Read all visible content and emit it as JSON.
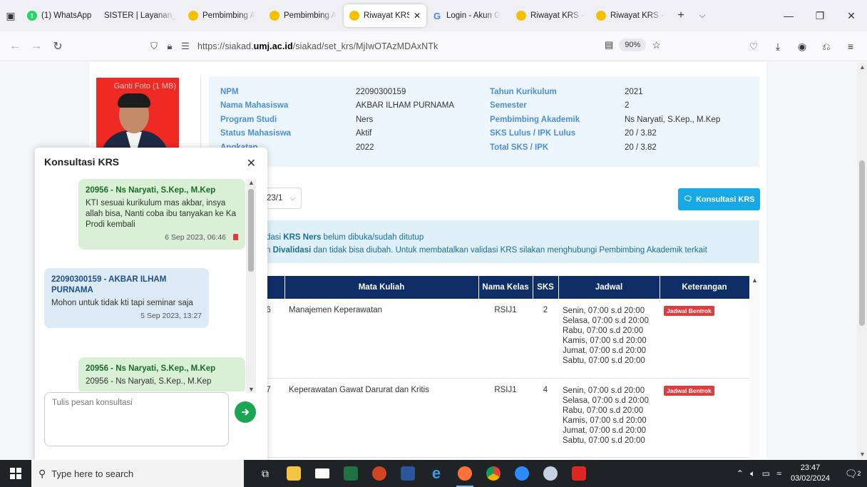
{
  "browser": {
    "tabs": [
      {
        "label": "(1) WhatsApp",
        "icon": "whatsapp-icon",
        "color": "#25d366",
        "active": false
      },
      {
        "label": "SISTER | Layanan_b",
        "icon": "sister-icon",
        "color": "#f0f0f4",
        "active": false
      },
      {
        "label": "Pembimbing A",
        "icon": "umj-icon",
        "color": "#f2c200",
        "active": false
      },
      {
        "label": "Pembimbing A",
        "icon": "umj-icon",
        "color": "#f2c200",
        "active": false
      },
      {
        "label": "Riwayat KRS",
        "icon": "umj-icon",
        "color": "#f2c200",
        "active": true
      },
      {
        "label": "Login - Akun G",
        "icon": "google-icon",
        "color": "#4285f4",
        "active": false
      },
      {
        "label": "Riwayat KRS - l",
        "icon": "umj-icon",
        "color": "#f2c200",
        "active": false
      },
      {
        "label": "Riwayat KRS - l",
        "icon": "umj-icon",
        "color": "#f2c200",
        "active": false
      }
    ],
    "url_prefix": "https://siakad.",
    "url_domain": "umj.ac.id",
    "url_path": "/siakad/set_krs/MjIwOTAzMDAxNTk",
    "zoom": "90%"
  },
  "profile": {
    "photo_label": "Ganti Foto (1 MB)",
    "left": [
      {
        "label": "NPM",
        "value": "22090300159"
      },
      {
        "label": "Nama Mahasiswa",
        "value": "AKBAR ILHAM PURNAMA"
      },
      {
        "label": "Program Studi",
        "value": "Ners"
      },
      {
        "label": "Status Mahasiswa",
        "value": "Aktif"
      },
      {
        "label": "Angkatan",
        "value": "2022"
      }
    ],
    "right": [
      {
        "label": "Tahun Kurikulum",
        "value": "2021"
      },
      {
        "label": "Semester",
        "value": "2"
      },
      {
        "label": "Pembimbing Akademik",
        "value": "Ns Naryati, S.Kep., M.Kep"
      },
      {
        "label": "SKS Lulus / IPK Lulus",
        "value": "20 / 3.82"
      },
      {
        "label": "Total SKS / IPK",
        "value": "20 / 3.82"
      }
    ]
  },
  "semester_select": "23/1",
  "konsultasi_button": "Konsultasi KRS",
  "alert": {
    "line1_pre": "dasi ",
    "line1_bold": "KRS Ners",
    "line1_post": " belum dibuka/sudah ditutup",
    "line2_pre": "n ",
    "line2_bold": "Divalidasi",
    "line2_post": " dan tidak bisa diubah. Untuk membatalkan validasi KRS silakan menghubungi Pembimbing Akademik terkait"
  },
  "table": {
    "headers": [
      "",
      "Mata Kuliah",
      "Nama Kelas",
      "SKS",
      "Jadwal",
      "Keterangan"
    ],
    "rows": [
      {
        "code": "06",
        "course": "Manajemen Keperawatan",
        "class": "RSIJ1",
        "sks": "2",
        "schedule": [
          "Senin, 07:00 s.d 20:00",
          "Selasa, 07:00 s.d 20:00",
          "Rabu, 07:00 s.d 20:00",
          "Kamis, 07:00 s.d 20:00",
          "Jumat, 07:00 s.d 20:00",
          "Sabtu, 07:00 s.d 20:00"
        ],
        "note": "Jadwal Bentrok"
      },
      {
        "code": "07",
        "course": "Keperawatan Gawat Darurat dan Kritis",
        "class": "RSIJ1",
        "sks": "4",
        "schedule": [
          "Senin, 07:00 s.d 20:00",
          "Selasa, 07:00 s.d 20:00",
          "Rabu, 07:00 s.d 20:00",
          "Kamis, 07:00 s.d 20:00",
          "Jumat, 07:00 s.d 20:00",
          "Sabtu, 07:00 s.d 20:00"
        ],
        "note": "Jadwal Bentrok"
      }
    ]
  },
  "chat": {
    "title": "Konsultasi KRS",
    "messages": [
      {
        "side": "right",
        "sender": "20956 - Ns Naryati, S.Kep., M.Kep",
        "text": "KTI sesuai kurikulum mas akbar, insya allah bisa, Nanti coba ibu tanyakan ke Ka Prodi kembali",
        "time": "6 Sep 2023, 06:46"
      },
      {
        "side": "left",
        "sender": "22090300159 - AKBAR ILHAM PURNAMA",
        "text": "Mohon untuk tidak kti tapi seminar saja",
        "time": "5 Sep 2023, 13:27"
      },
      {
        "side": "right",
        "sender": "20956 - Ns Naryati, S.Kep., M.Kep",
        "text": "20956 - Ns Naryati, S.Kep., M.Kep",
        "time": ""
      }
    ],
    "input_placeholder": "Tulis pesan konsultasi"
  },
  "taskbar": {
    "search_placeholder": "Type here to search",
    "time": "23:47",
    "date": "03/02/2024",
    "notif_count": "2"
  }
}
